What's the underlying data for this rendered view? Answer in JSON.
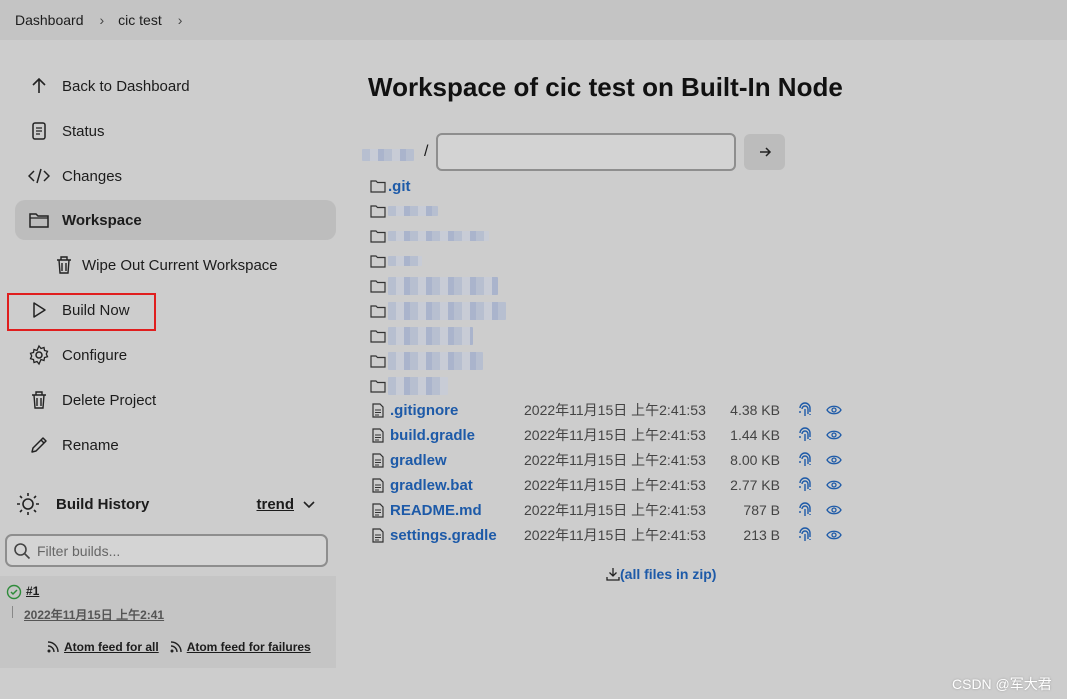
{
  "breadcrumb": {
    "items": [
      "Dashboard",
      "cic test"
    ]
  },
  "sidebar": {
    "tasks": [
      {
        "label": "Back to Dashboard",
        "icon": "arrow-up-icon"
      },
      {
        "label": "Status",
        "icon": "document-icon"
      },
      {
        "label": "Changes",
        "icon": "code-icon"
      },
      {
        "label": "Workspace",
        "icon": "folder-icon",
        "active": true
      },
      {
        "label": "Wipe Out Current Workspace",
        "icon": "trash-icon"
      },
      {
        "label": "Build Now",
        "icon": "play-icon"
      },
      {
        "label": "Configure",
        "icon": "gear-icon"
      },
      {
        "label": "Delete Project",
        "icon": "trash-icon"
      },
      {
        "label": "Rename",
        "icon": "pencil-icon"
      }
    ],
    "highlight_color": "#e01e1e"
  },
  "build_history": {
    "title": "Build History",
    "trend_label": "trend",
    "filter_placeholder": "Filter builds...",
    "builds": [
      {
        "number": "#1",
        "date": "2022年11月15日 上午2:41",
        "status": "success"
      }
    ],
    "feeds": [
      "Atom feed for all",
      "Atom feed for failures"
    ]
  },
  "main": {
    "title": "Workspace of cic test on Built-In Node",
    "path_separator": "/",
    "path_input_value": "",
    "dirs": [
      ".git"
    ],
    "files": [
      {
        "name": ".gitignore",
        "date": "2022年11月15日 上午2:41:53",
        "size": "4.38 KB"
      },
      {
        "name": "build.gradle",
        "date": "2022年11月15日 上午2:41:53",
        "size": "1.44 KB"
      },
      {
        "name": "gradlew",
        "date": "2022年11月15日 上午2:41:53",
        "size": "8.00 KB"
      },
      {
        "name": "gradlew.bat",
        "date": "2022年11月15日 上午2:41:53",
        "size": "2.77 KB"
      },
      {
        "name": "README.md",
        "date": "2022年11月15日 上午2:41:53",
        "size": "787 B"
      },
      {
        "name": "settings.gradle",
        "date": "2022年11月15日 上午2:41:53",
        "size": "213 B"
      }
    ],
    "zip_label": "(all files in zip)",
    "link_color": "#1d5aa8"
  },
  "watermark": "CSDN @军大君"
}
